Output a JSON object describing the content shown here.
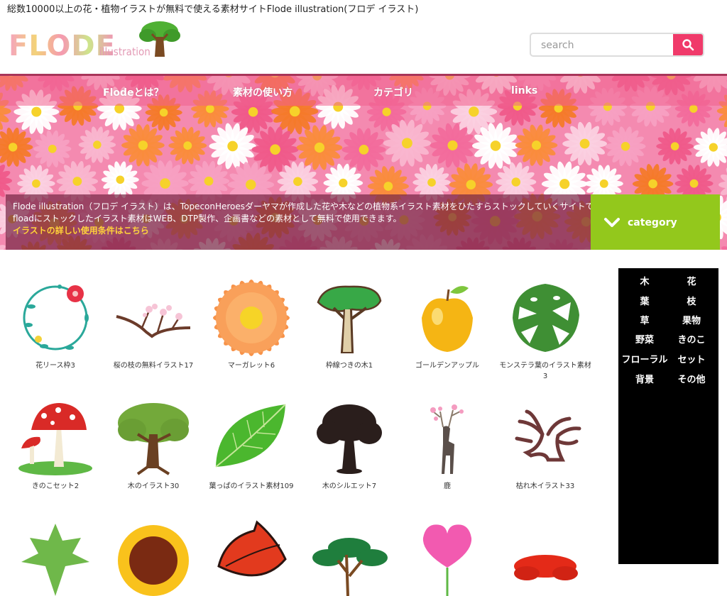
{
  "tagline": "総数10000以上の花・植物イラストが無料で使える素材サイトFlode illustration(フロデ イラスト)",
  "logo": {
    "main": "FLODE",
    "sub": "illustration"
  },
  "search": {
    "placeholder": "search"
  },
  "nav": [
    "Flodeとは？",
    "素材の使い方",
    "カテゴリ",
    "links"
  ],
  "intro": {
    "line1": "Flode illustration（フロデ イラスト）は、TopeconHeroesダーヤマが作成した花や木などの植物系イラスト素材をひたすらストックしていくサイトです。",
    "line2": "floadにストックしたイラスト素材はWEB、DTP製作、企画書などの素材として無料で使用できます。",
    "link": "イラストの詳しい使用条件はこちら"
  },
  "category_button": "category",
  "sidebar_categories": [
    "木",
    "花",
    "葉",
    "枝",
    "草",
    "果物",
    "野菜",
    "きのこ",
    "フローラル",
    "セット",
    "背景",
    "その他"
  ],
  "items": [
    {
      "caption": "花リース枠3",
      "icon": "flower-wreath-icon"
    },
    {
      "caption": "桜の枝の無料イラスト17",
      "icon": "cherry-branch-icon"
    },
    {
      "caption": "マーガレット6",
      "icon": "marguerite-icon"
    },
    {
      "caption": "枠線つきの木1",
      "icon": "outlined-tree-icon"
    },
    {
      "caption": "ゴールデンアップル",
      "icon": "golden-apple-icon"
    },
    {
      "caption": "モンステラ葉のイラスト素材3",
      "icon": "monstera-leaf-icon"
    },
    {
      "caption": "きのこセット2",
      "icon": "mushroom-set-icon"
    },
    {
      "caption": "木のイラスト30",
      "icon": "tree-icon"
    },
    {
      "caption": "葉っぱのイラスト素材109",
      "icon": "green-leaf-icon"
    },
    {
      "caption": "木のシルエット7",
      "icon": "tree-silhouette-icon"
    },
    {
      "caption": "鹿",
      "icon": "deer-icon"
    },
    {
      "caption": "枯れ木イラスト33",
      "icon": "dead-tree-icon"
    },
    {
      "caption": "",
      "icon": "maple-leaf-icon"
    },
    {
      "caption": "",
      "icon": "sunflower-icon"
    },
    {
      "caption": "",
      "icon": "red-leaf-icon"
    },
    {
      "caption": "",
      "icon": "bonsai-tree-icon"
    },
    {
      "caption": "",
      "icon": "heart-flower-icon"
    },
    {
      "caption": "",
      "icon": "red-maple-tree-icon"
    }
  ]
}
